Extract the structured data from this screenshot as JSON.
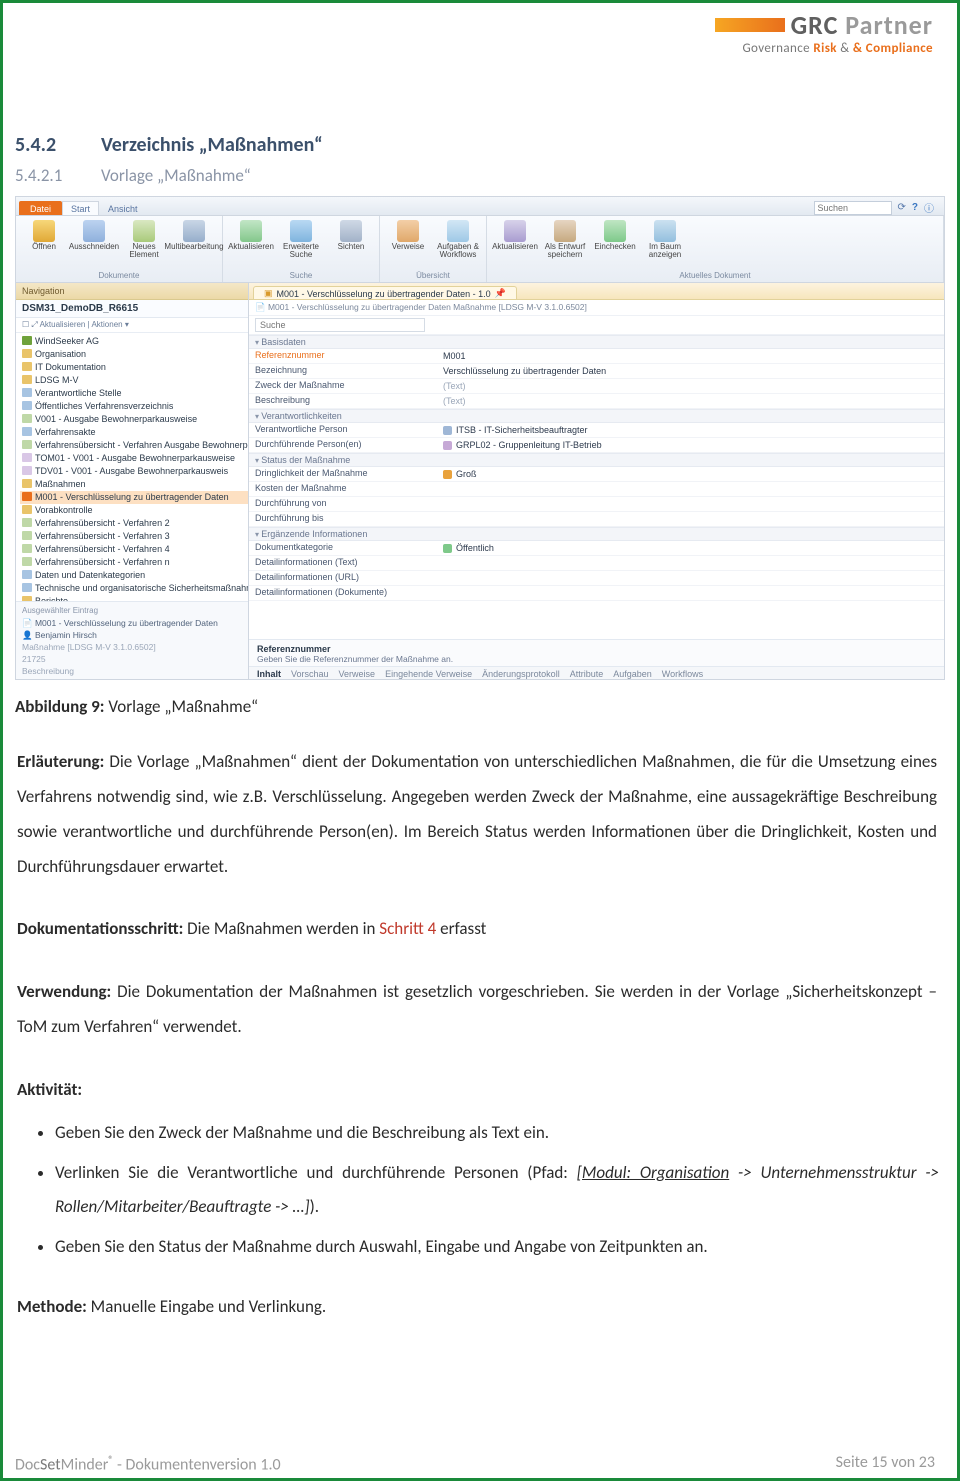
{
  "logo": {
    "brand": "GRC",
    "brand2": "Partner",
    "sub_pre": "Governance",
    "sub_mid": "Risk",
    "sub_post": "& Compliance",
    "amp": "&"
  },
  "doc": {
    "h1_num": "5.4.2",
    "h1": "Verzeichnis „Maßnahmen“",
    "h2_num": "5.4.2.1",
    "h2": "Vorlage „Maßnahme“",
    "caption_b": "Abbildung 9:",
    "caption": "Vorlage „Maßnahme“",
    "p1_b": "Erläuterung:",
    "p1": " Die Vorlage „Maßnahmen“ dient der Dokumentation von unterschiedlichen Maßnahmen, die für die Umsetzung eines Verfahrens notwendig sind, wie z.B. Verschlüsselung. Angegeben werden Zweck der Maßnahme, eine aussagekräftige Beschreibung sowie verantwortliche und durchführende Person(en). Im Bereich Status werden Informationen über die Dringlichkeit, Kosten und Durchführungsdauer erwartet.",
    "p2_b": "Dokumentationsschritt:",
    "p2_a": " Die Maßnahmen werden in ",
    "p2_red": "Schritt 4",
    "p2_b2": " erfasst",
    "p3_b": "Verwendung:",
    "p3": " Die Dokumentation der Maßnahmen ist gesetzlich vorgeschrieben. Sie werden in der Vorlage „Sicherheitskonzept – ToM zum Verfahren“ verwendet.",
    "p4_b": "Aktivität:",
    "li1": "Geben Sie den Zweck der Maßnahme und die Beschreibung als Text ein.",
    "li2a": "Verlinken Sie die Verantwortliche und durchführende Personen (Pfad: ",
    "li2b": "[Modul: Organisation",
    "li2c": " -> Unternehmensstruktur -> Rollen/Mitarbeiter/Beauftragte -> …]",
    "li2d": ").",
    "li3": "Geben Sie den Status der Maßnahme durch Auswahl, Eingabe und Angabe von Zeitpunkten an.",
    "p5_b": "Methode:",
    "p5": " Manuelle Eingabe und Verlinkung.",
    "foot_l_a": "Doc",
    "foot_l_b": "Set",
    "foot_l_c": "Minder",
    "foot_l_r": "®",
    "foot_mid": "  - Dokumentenversion 1.0",
    "foot_r": "Seite 15 von 23"
  },
  "shot": {
    "search_ph": "Suchen",
    "tabs": {
      "file": "Datei",
      "start": "Start",
      "ansicht": "Ansicht"
    },
    "groups": {
      "g1": "Dokumente",
      "g2": "Suche",
      "g3": "Übersicht",
      "g4": "Aktuelles Dokument"
    },
    "btn": {
      "open": "Öffnen",
      "cut": "Ausschneiden",
      "new": "Neues Element",
      "multi": "Multibearbeitung",
      "refresh": "Aktualisieren",
      "extend": "Erweiterte Suche",
      "views": "Sichten",
      "links": "Verweise",
      "tasks": "Aufgaben & Workflows",
      "update": "Aktualisieren",
      "draft": "Als Entwurf speichern",
      "checkin": "Einchecken",
      "tree": "Im Baum anzeigen"
    },
    "nav": {
      "hd": "Navigation",
      "db": "DSM31_DemoDB_R6615",
      "tools": "☐ ⤢  Aktualisieren | Aktionen ▾",
      "tree": [
        {
          "cls": "c-root",
          "ind": "",
          "t": "WindSeeker AG"
        },
        {
          "cls": "c-fold",
          "ind": "ind1",
          "t": "Organisation"
        },
        {
          "cls": "c-fold",
          "ind": "ind1",
          "t": "IT Dokumentation"
        },
        {
          "cls": "c-fold",
          "ind": "ind1",
          "t": "LDSG M-V"
        },
        {
          "cls": "c-sub",
          "ind": "ind2",
          "t": "Verantwortliche Stelle"
        },
        {
          "cls": "c-sub",
          "ind": "ind2",
          "t": "Öffentliches Verfahrensverzeichnis"
        },
        {
          "cls": "c-doc",
          "ind": "ind3",
          "t": "V001 - Ausgabe Bewohnerparkausweise"
        },
        {
          "cls": "c-sub",
          "ind": "ind2",
          "t": "Verfahrensakte"
        },
        {
          "cls": "c-doc",
          "ind": "ind3",
          "t": "Verfahrensübersicht - Verfahren Ausgabe Bewohnerparkausweise"
        },
        {
          "cls": "c-doc2",
          "ind": "ind4",
          "t": "TOM01 - V001 - Ausgabe Bewohnerparkausweise"
        },
        {
          "cls": "c-doc2",
          "ind": "ind4",
          "t": "TDV01 - V001 - Ausgabe Bewohnerparkausweis"
        },
        {
          "cls": "c-fold",
          "ind": "ind4",
          "t": "Maßnahmen"
        },
        {
          "cls": "c-sel",
          "ind": "ind5",
          "t": "M001 - Verschlüsselung zu übertragender Daten",
          "sel": true
        },
        {
          "cls": "c-fold",
          "ind": "ind4",
          "t": "Vorabkontrolle"
        },
        {
          "cls": "c-doc",
          "ind": "ind3",
          "t": "Verfahrensübersicht - Verfahren 2"
        },
        {
          "cls": "c-doc",
          "ind": "ind3",
          "t": "Verfahrensübersicht - Verfahren 3"
        },
        {
          "cls": "c-doc",
          "ind": "ind3",
          "t": "Verfahrensübersicht - Verfahren 4"
        },
        {
          "cls": "c-doc",
          "ind": "ind3",
          "t": "Verfahrensübersicht - Verfahren n"
        },
        {
          "cls": "c-sub",
          "ind": "ind2",
          "t": "Daten und Datenkategorien"
        },
        {
          "cls": "c-sub",
          "ind": "ind2",
          "t": "Technische und organisatorische Sicherheitsmaßnahmen (TOM)"
        },
        {
          "cls": "c-fold",
          "ind": "ind1",
          "t": "Berichte"
        }
      ],
      "sel": {
        "hd": "Ausgewählter Eintrag",
        "l1": "M001 - Verschlüsselung zu übertragender Daten",
        "l2": "Benjamin Hirsch",
        "l3": "Maßnahme [LDSG M-V 3.1.0.6502]",
        "l4": "21725",
        "l5": "Beschreibung"
      }
    },
    "content": {
      "tab": "M001 - Verschlüsselung zu übertragender Daten - 1.0",
      "crumb": "M001 - Verschlüsselung zu übertragender Daten  Maßnahme [LDSG M-V 3.1.0.6502]",
      "search": "Suche",
      "sects": {
        "s1": "Basisdaten",
        "s2": "Verantwortlichkeiten",
        "s3": "Status der Maßnahme",
        "s4": "Ergänzende Informationen"
      },
      "rows": {
        "ref_l": "Referenznummer",
        "ref_v": "M001",
        "bez_l": "Bezeichnung",
        "bez_v": "Verschlüsselung zu übertragender Daten",
        "zwk_l": "Zweck der Maßnahme",
        "zwk_v": "(Text)",
        "bes_l": "Beschreibung",
        "bes_v": "(Text)",
        "vp_l": "Verantwortliche Person",
        "vp_v": "ITSB - IT-Sicherheitsbeauftragter",
        "dp_l": "Durchführende Person(en)",
        "dp_v": "GRPL02 - Gruppenleitung IT-Betrieb",
        "dr_l": "Dringlichkeit der Maßnahme",
        "dr_v": "Groß",
        "ko_l": "Kosten der Maßnahme",
        "ko_v": "",
        "dv_l": "Durchführung von",
        "dv_v": "",
        "db_l": "Durchführung bis",
        "db_v": "",
        "dk_l": "Dokumentkategorie",
        "dk_v": "Öffentlich",
        "dt_l": "Detailinformationen (Text)",
        "dt_v": "",
        "du_l": "Detailinformationen (URL)",
        "du_v": "",
        "dd_l": "Detailinformationen (Dokumente)",
        "dd_v": ""
      },
      "help": {
        "t": "Referenznummer",
        "s": "Geben Sie die Referenznummer der Maßnahme an."
      },
      "btabs": [
        "Inhalt",
        "Vorschau",
        "Verweise",
        "Eingehende Verweise",
        "Änderungsprotokoll",
        "Attribute",
        "Aufgaben",
        "Workflows"
      ]
    }
  }
}
